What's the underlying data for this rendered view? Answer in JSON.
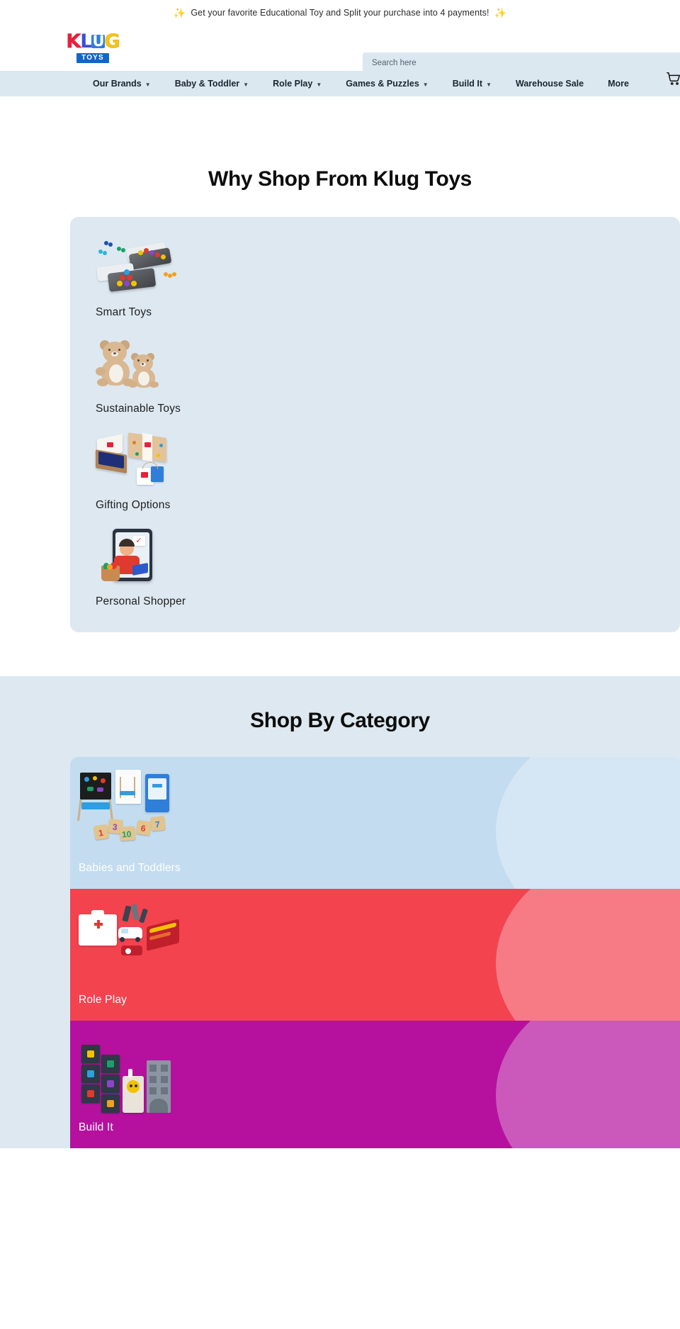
{
  "promo": {
    "text": "Get your favorite Educational Toy and Split your purchase into 4 payments!",
    "sparkle_left": "✨",
    "sparkle_right": "✨"
  },
  "header": {
    "logo": {
      "letters": [
        "K",
        "L",
        "U",
        "G"
      ],
      "subtitle": "TOYS",
      "colors": {
        "k": "#e8203a",
        "l": "#3b4fd4",
        "u_bg": "#2f7ed8",
        "g": "#f5c518",
        "toys_bg": "#1266c9"
      }
    },
    "search": {
      "placeholder": "Search here",
      "value": ""
    },
    "cart": {
      "icon": "shopping-cart-icon"
    }
  },
  "nav": {
    "background": "#dce8f0",
    "items": [
      {
        "label": "Our Brands",
        "has_dropdown": true,
        "caret": "▼"
      },
      {
        "label": "Baby & Toddler",
        "has_dropdown": true,
        "caret": "▼"
      },
      {
        "label": "Role Play",
        "has_dropdown": true,
        "caret": "▼"
      },
      {
        "label": "Games & Puzzles",
        "has_dropdown": true,
        "caret": "▼"
      },
      {
        "label": "Build It",
        "has_dropdown": true,
        "caret": "▼"
      },
      {
        "label": "Warehouse Sale",
        "has_dropdown": false,
        "caret": ""
      },
      {
        "label": "More",
        "has_dropdown": false,
        "caret": ""
      }
    ]
  },
  "why_shop": {
    "title": "Why Shop From Klug Toys",
    "card_background": "#dde8f1",
    "features": [
      {
        "label": "Smart Toys",
        "icon": "puzzle-game-icon"
      },
      {
        "label": "Sustainable Toys",
        "icon": "wooden-bears-icon"
      },
      {
        "label": "Gifting Options",
        "icon": "gift-boxes-icon"
      },
      {
        "label": "Personal Shopper",
        "icon": "personal-shopper-icon"
      }
    ]
  },
  "shop_by_category": {
    "title": "Shop By Category",
    "section_background": "#dde8f1",
    "cards": [
      {
        "label": "Babies and Toddlers",
        "color": "#c3dcef",
        "art": "easel-numbers-icon"
      },
      {
        "label": "Role Play",
        "color": "#f2434f",
        "art": "doctor-kit-icon"
      },
      {
        "label": "Build It",
        "color": "#b5119e",
        "art": "building-blocks-icon"
      }
    ]
  }
}
